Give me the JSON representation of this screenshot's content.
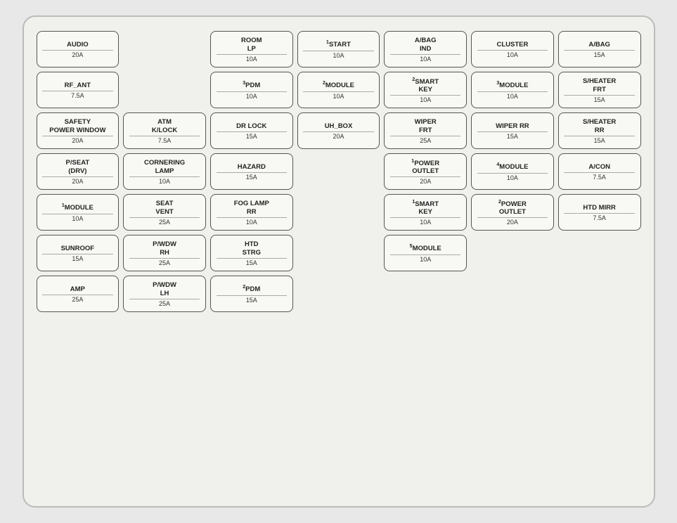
{
  "board": {
    "rows": [
      [
        {
          "label": "AUDIO",
          "amp": "20A",
          "sup": ""
        },
        {
          "label": "",
          "amp": "",
          "sup": "",
          "empty": true
        },
        {
          "label": "ROOM\nLP",
          "amp": "10A",
          "sup": ""
        },
        {
          "label": "START",
          "amp": "10A",
          "sup": "1"
        },
        {
          "label": "A/BAG\nIND",
          "amp": "10A",
          "sup": ""
        },
        {
          "label": "CLUSTER",
          "amp": "10A",
          "sup": ""
        },
        {
          "label": "A/BAG",
          "amp": "15A",
          "sup": ""
        }
      ],
      [
        {
          "label": "RF_ANT",
          "amp": "7.5A",
          "sup": ""
        },
        {
          "label": "",
          "amp": "",
          "sup": "",
          "empty": true
        },
        {
          "label": "PDM",
          "amp": "10A",
          "sup": "3"
        },
        {
          "label": "MODULE",
          "amp": "10A",
          "sup": "2"
        },
        {
          "label": "SMART\nKEY",
          "amp": "10A",
          "sup": "2"
        },
        {
          "label": "MODULE",
          "amp": "10A",
          "sup": "3"
        },
        {
          "label": "S/HEATER\nFRT",
          "amp": "15A",
          "sup": ""
        }
      ],
      [
        {
          "label": "SAFETY\nPOWER WINDOW",
          "amp": "20A",
          "sup": ""
        },
        {
          "label": "ATM\nK/LOCK",
          "amp": "7.5A",
          "sup": ""
        },
        {
          "label": "DR LOCK",
          "amp": "15A",
          "sup": ""
        },
        {
          "label": "UH_BOX",
          "amp": "20A",
          "sup": ""
        },
        {
          "label": "WIPER\nFRT",
          "amp": "25A",
          "sup": ""
        },
        {
          "label": "WIPER RR",
          "amp": "15A",
          "sup": ""
        },
        {
          "label": "S/HEATER\nRR",
          "amp": "15A",
          "sup": ""
        }
      ],
      [
        {
          "label": "P/SEAT\n(DRV)",
          "amp": "20A",
          "sup": ""
        },
        {
          "label": "CORNERING\nLAMP",
          "amp": "10A",
          "sup": ""
        },
        {
          "label": "HAZARD",
          "amp": "15A",
          "sup": ""
        },
        {
          "label": "",
          "amp": "",
          "sup": "",
          "empty": true
        },
        {
          "label": "POWER\nOUTLET",
          "amp": "20A",
          "sup": "1"
        },
        {
          "label": "MODULE",
          "amp": "10A",
          "sup": "4"
        },
        {
          "label": "A/CON",
          "amp": "7.5A",
          "sup": ""
        }
      ],
      [
        {
          "label": "MODULE",
          "amp": "10A",
          "sup": "1"
        },
        {
          "label": "SEAT\nVENT",
          "amp": "25A",
          "sup": ""
        },
        {
          "label": "FOG LAMP\nRR",
          "amp": "10A",
          "sup": ""
        },
        {
          "label": "",
          "amp": "",
          "sup": "",
          "empty": true
        },
        {
          "label": "SMART\nKEY",
          "amp": "10A",
          "sup": "1"
        },
        {
          "label": "POWER\nOUTLET",
          "amp": "20A",
          "sup": "2"
        },
        {
          "label": "HTD MIRR",
          "amp": "7.5A",
          "sup": ""
        }
      ],
      [
        {
          "label": "SUNROOF",
          "amp": "15A",
          "sup": ""
        },
        {
          "label": "P/WDW\nRH",
          "amp": "25A",
          "sup": ""
        },
        {
          "label": "HTD\nSTRG",
          "amp": "15A",
          "sup": ""
        },
        {
          "label": "",
          "amp": "",
          "sup": "",
          "empty": true
        },
        {
          "label": "MODULE",
          "amp": "10A",
          "sup": "5"
        },
        {
          "label": "",
          "amp": "",
          "sup": "",
          "empty": true
        },
        {
          "label": "",
          "amp": "",
          "sup": "",
          "empty": true
        }
      ],
      [
        {
          "label": "AMP",
          "amp": "25A",
          "sup": ""
        },
        {
          "label": "P/WDW\nLH",
          "amp": "25A",
          "sup": ""
        },
        {
          "label": "PDM",
          "amp": "15A",
          "sup": "2"
        },
        {
          "label": "",
          "amp": "",
          "sup": "",
          "empty": true
        },
        {
          "label": "",
          "amp": "",
          "sup": "",
          "empty": true
        },
        {
          "label": "",
          "amp": "",
          "sup": "",
          "empty": true
        },
        {
          "label": "",
          "amp": "",
          "sup": "",
          "empty": true
        }
      ]
    ]
  }
}
